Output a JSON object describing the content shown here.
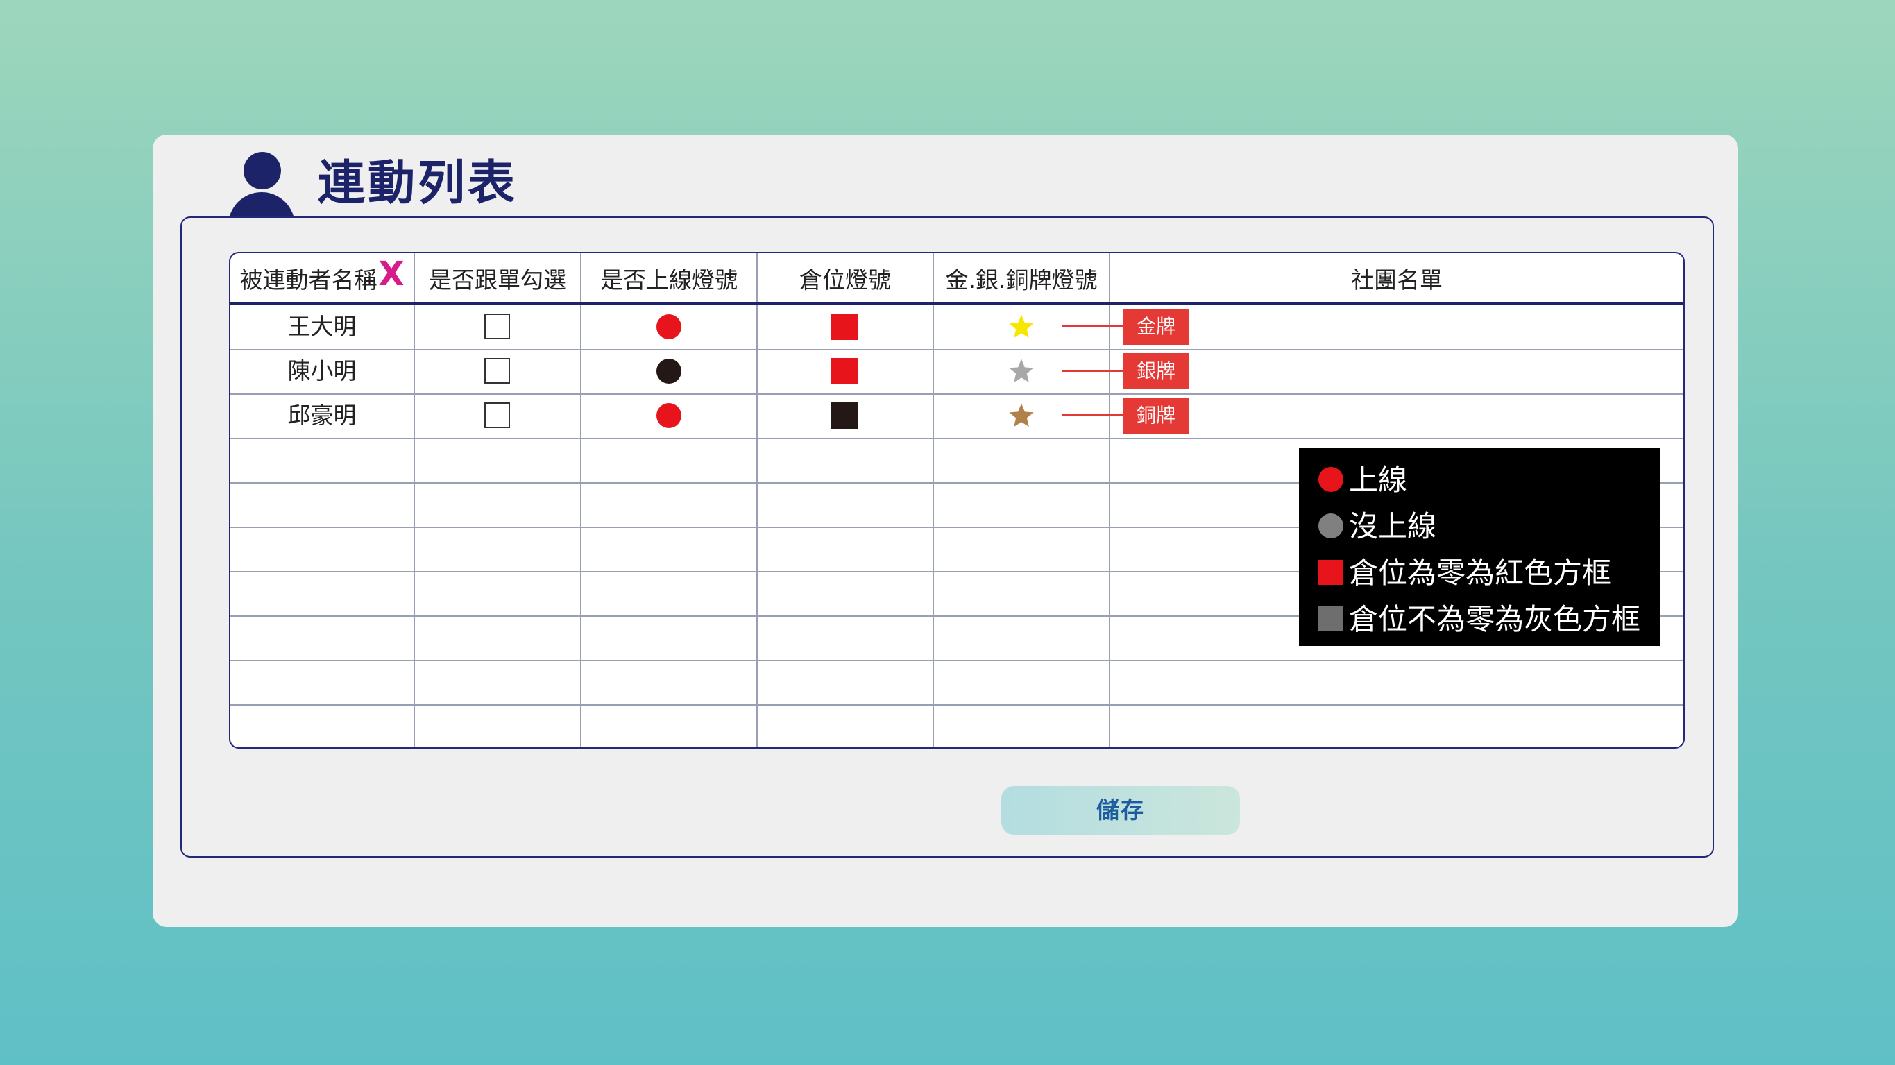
{
  "page": {
    "title": "連動列表"
  },
  "table": {
    "headers": [
      "被連動者名稱",
      "是否跟單勾選",
      "是否上線燈號",
      "倉位燈號",
      "金.銀.銅牌燈號",
      "社團名單"
    ],
    "header_mark": "X",
    "rows": [
      {
        "name": "王大明",
        "online": "red",
        "position": "red",
        "medal_star": "gold",
        "medal": "金牌"
      },
      {
        "name": "陳小明",
        "online": "black",
        "position": "red",
        "medal_star": "silver",
        "medal": "銀牌"
      },
      {
        "name": "邱豪明",
        "online": "red",
        "position": "black",
        "medal_star": "bronze",
        "medal": "銅牌"
      }
    ],
    "empty_rows": 7
  },
  "legend": {
    "items": [
      {
        "shape": "circle",
        "color": "#e8141c",
        "label": "上線"
      },
      {
        "shape": "circle",
        "color": "#808080",
        "label": "沒上線"
      },
      {
        "shape": "square",
        "color": "#e8141c",
        "label": "倉位為零為紅色方框"
      },
      {
        "shape": "square",
        "color": "#6e6e6e",
        "label": "倉位不為零為灰色方框"
      }
    ]
  },
  "actions": {
    "save_label": "儲存"
  },
  "colors": {
    "navy": "#1c2368",
    "red": "#e8141c",
    "black": "#231815",
    "gold": "#f7e600",
    "silver": "#a8a8a8",
    "bronze": "#b0824a",
    "medal_bg": "#e53935",
    "checkmark_x": "#d81b8a"
  }
}
